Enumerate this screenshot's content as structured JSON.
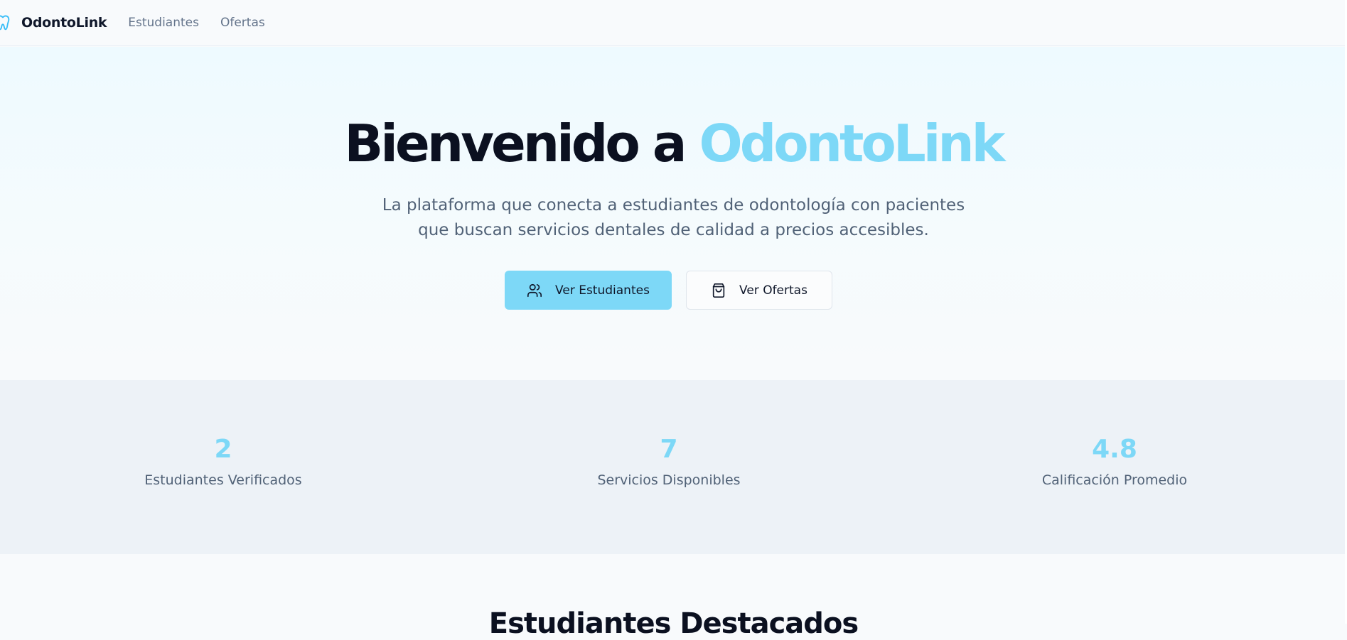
{
  "nav": {
    "brand": "OdontoLink",
    "links": [
      "Estudiantes",
      "Ofertas"
    ]
  },
  "hero": {
    "title_part1": "Bienvenido a ",
    "title_part2": "OdontoLink",
    "subtitle": "La plataforma que conecta a estudiantes de odontología con pacientes que buscan servicios dentales de calidad a precios accesibles.",
    "primary_button": "Ver Estudiantes",
    "secondary_button": "Ver Ofertas"
  },
  "stats": [
    {
      "value": "2",
      "label": "Estudiantes Verificados"
    },
    {
      "value": "7",
      "label": "Servicios Disponibles"
    },
    {
      "value": "4.8",
      "label": "Calificación Promedio"
    }
  ],
  "featured": {
    "title": "Estudiantes Destacados"
  },
  "colors": {
    "accent": "#7dd8f7",
    "text_dark": "#0b1020",
    "text_muted": "#516277",
    "stats_bg": "#edf2f7"
  },
  "icons": {
    "brand": "tooth-icon",
    "primary_button": "users-icon",
    "secondary_button": "shopping-bag-icon"
  }
}
